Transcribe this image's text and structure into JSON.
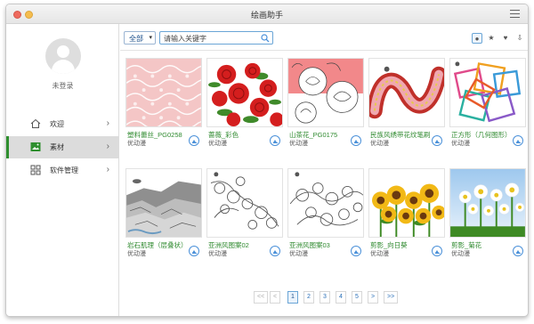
{
  "app": {
    "title": "绘画助手"
  },
  "sidebar": {
    "login_label": "未登录",
    "items": [
      {
        "label": "欢迎",
        "icon": "home-icon",
        "active": false
      },
      {
        "label": "素材",
        "icon": "image-icon",
        "active": true
      },
      {
        "label": "软件管理",
        "icon": "grid-icon",
        "active": false
      }
    ]
  },
  "toolbar": {
    "category_label": "全部",
    "search_placeholder": "请输入关键字",
    "filters": [
      {
        "icon": "circle-filter-icon",
        "glyph": "●",
        "active": true
      },
      {
        "icon": "star-icon",
        "glyph": "★",
        "active": false
      },
      {
        "icon": "heart-icon",
        "glyph": "♥",
        "active": false
      },
      {
        "icon": "download-tray-icon",
        "glyph": "⇩",
        "active": false
      }
    ]
  },
  "items": [
    {
      "name": "塑料蕾丝_PG0258",
      "author": "优动漫"
    },
    {
      "name": "蔷薇_彩色",
      "author": "优动漫"
    },
    {
      "name": "山茶花_PG0175",
      "author": "优动漫"
    },
    {
      "name": "民族风绣带花纹笔刷",
      "author": "优动漫"
    },
    {
      "name": "正方形（几何图形）",
      "author": "优动漫"
    },
    {
      "name": "岩石肌理（层叠状）",
      "author": "优动漫"
    },
    {
      "name": "亚洲风图案02",
      "author": "优动漫"
    },
    {
      "name": "亚洲风图案03",
      "author": "优动漫"
    },
    {
      "name": "剪影_向日葵",
      "author": "优动漫"
    },
    {
      "name": "剪影_菊花",
      "author": "优动漫"
    }
  ],
  "pagination": {
    "first": "<<",
    "prev": "<",
    "pages": [
      "1",
      "2",
      "3",
      "4",
      "5"
    ],
    "current": "1",
    "next": ">",
    "last": ">>"
  },
  "colors": {
    "accent": "#2f8f2f",
    "link": "#2a6fb8",
    "card_title": "#2f8a2f"
  }
}
